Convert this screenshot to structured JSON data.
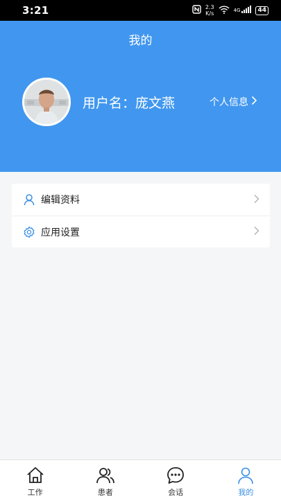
{
  "status_bar": {
    "time": "3:21",
    "speed_value": "2.3",
    "speed_unit": "K/s",
    "network": "4G",
    "battery": "44"
  },
  "header": {
    "title": "我的",
    "username_label": "用户名：",
    "username_value": "庞文燕",
    "profile_link": "个人信息"
  },
  "menu": {
    "items": [
      {
        "label": "编辑资料",
        "icon": "user-icon"
      },
      {
        "label": "应用设置",
        "icon": "gear-icon"
      }
    ]
  },
  "tabbar": {
    "tabs": [
      {
        "label": "工作",
        "icon": "home-icon"
      },
      {
        "label": "患者",
        "icon": "users-icon"
      },
      {
        "label": "会话",
        "icon": "chat-icon"
      },
      {
        "label": "我的",
        "icon": "user-icon",
        "active": true
      }
    ]
  },
  "colors": {
    "header_bg": "#4197ef",
    "accent": "#3a8ee6",
    "page_bg": "#f5f6f8"
  }
}
